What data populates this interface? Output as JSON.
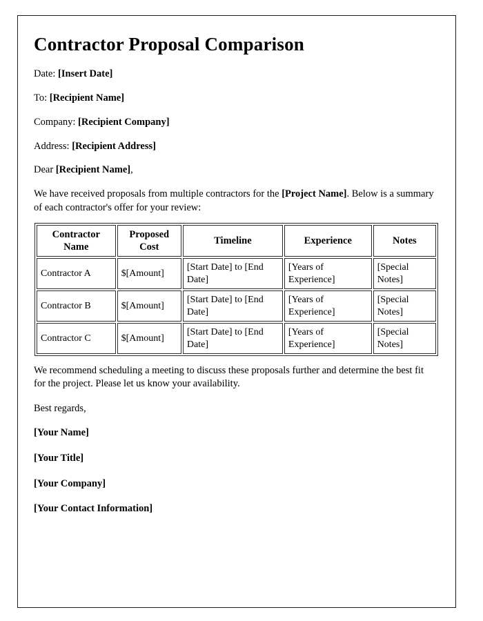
{
  "document": {
    "title": "Contractor Proposal Comparison",
    "meta": [
      {
        "label": "Date: ",
        "value": "[Insert Date]"
      },
      {
        "label": "To: ",
        "value": "[Recipient Name]"
      },
      {
        "label": "Company: ",
        "value": "[Recipient Company]"
      },
      {
        "label": "Address: ",
        "value": "[Recipient Address]"
      },
      {
        "label": "Dear ",
        "value": "[Recipient Name]",
        "suffix": ","
      }
    ],
    "intro": {
      "before": "We have received proposals from multiple contractors for the ",
      "placeholder": "[Project Name]",
      "after": ". Below is a summary of each contractor's offer for your review:"
    },
    "table": {
      "headers": [
        "Contractor Name",
        "Proposed Cost",
        "Timeline",
        "Experience",
        "Notes"
      ],
      "rows": [
        {
          "name": "Contractor A",
          "cost": "$[Amount]",
          "timeline": "[Start Date] to [End Date]",
          "experience": "[Years of Experience]",
          "notes": "[Special Notes]"
        },
        {
          "name": "Contractor B",
          "cost": "$[Amount]",
          "timeline": "[Start Date] to [End Date]",
          "experience": "[Years of Experience]",
          "notes": "[Special Notes]"
        },
        {
          "name": "Contractor C",
          "cost": "$[Amount]",
          "timeline": "[Start Date] to [End Date]",
          "experience": "[Years of Experience]",
          "notes": "[Special Notes]"
        }
      ]
    },
    "closing": "We recommend scheduling a meeting to discuss these proposals further and determine the best fit for the project. Please let us know your availability.",
    "regards": "Best regards,",
    "signature": [
      "[Your Name]",
      "[Your Title]",
      "[Your Company]",
      "[Your Contact Information]"
    ]
  },
  "colors": {
    "page_background": "#ffffff",
    "text": "#000000",
    "page_border": "#1a1a1a",
    "table_border": "#2b2b2b"
  }
}
